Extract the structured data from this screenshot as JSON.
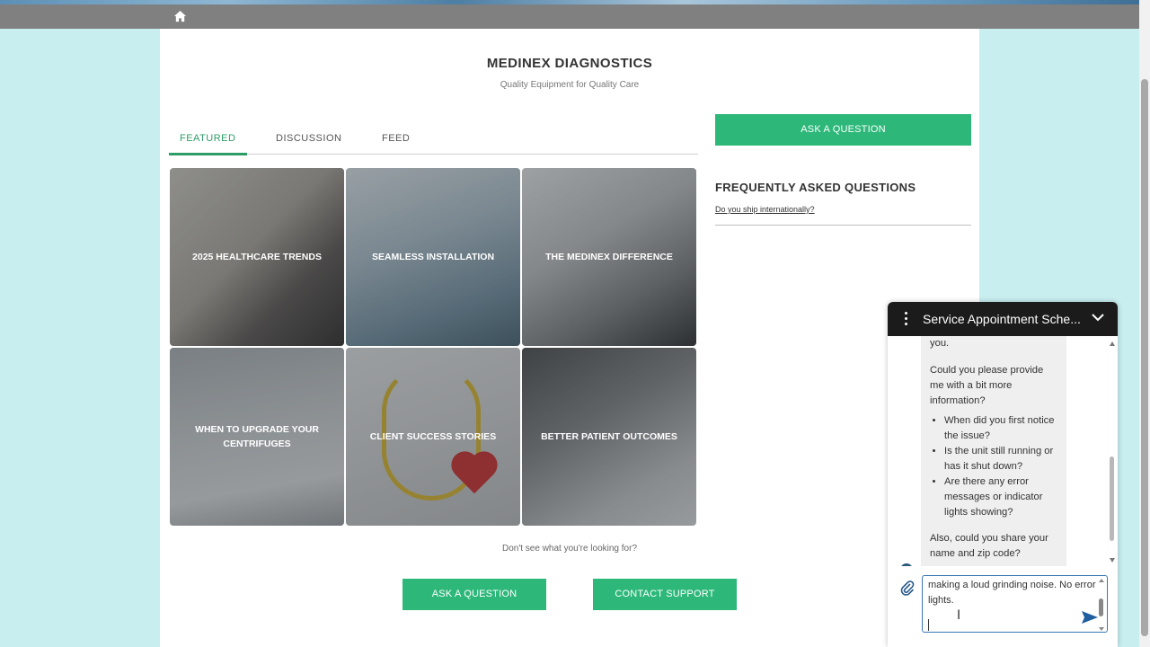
{
  "colors": {
    "accent": "#2db87a",
    "tab_active": "#2d9d68",
    "chat_header": "#1b1b1b",
    "page_bg": "#c8eef0"
  },
  "nav": {
    "home_icon": "home-icon"
  },
  "brand": {
    "title": "MEDINEX DIAGNOSTICS",
    "subtitle": "Quality Equipment for Quality Care"
  },
  "tabs": [
    {
      "label": "FEATURED",
      "active": true
    },
    {
      "label": "DISCUSSION",
      "active": false
    },
    {
      "label": "FEED",
      "active": false
    }
  ],
  "tiles": [
    {
      "label": "2025 HEALTHCARE TRENDS"
    },
    {
      "label": "SEAMLESS INSTALLATION"
    },
    {
      "label": "THE MEDINEX DIFFERENCE"
    },
    {
      "label": "WHEN TO UPGRADE YOUR CENTRIFUGES"
    },
    {
      "label": "CLIENT SUCCESS STORIES"
    },
    {
      "label": "BETTER PATIENT OUTCOMES"
    }
  ],
  "footer": {
    "not_found": "Don't see what you're looking for?",
    "ask_button": "ASK A QUESTION",
    "contact_button": "CONTACT SUPPORT"
  },
  "sidebar": {
    "ask_button": "ASK A QUESTION",
    "faq_title": "FREQUENTLY ASKED QUESTIONS",
    "faq_items": [
      {
        "label": "Do you ship internationally?"
      }
    ]
  },
  "chat": {
    "title": "Service Appointment Sche...",
    "message": {
      "lead": "you.",
      "question": "Could you please provide me with a bit more information?",
      "bullets": [
        "When did you first notice the issue?",
        "Is the unit still running or has it shut down?",
        "Are there any error messages or indicator lights showing?"
      ],
      "followup": "Also, could you share your name and zip code?"
    },
    "input_value": "making a loud grinding noise. No error lights."
  }
}
